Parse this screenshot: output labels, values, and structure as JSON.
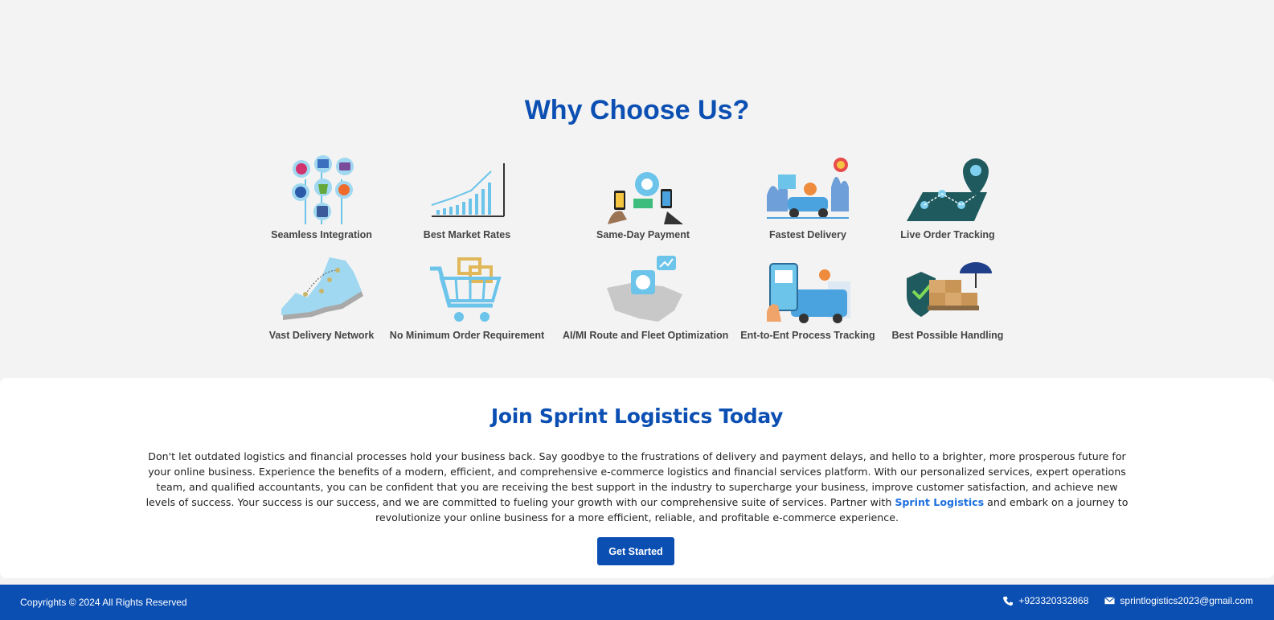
{
  "why": {
    "title": "Why Choose Us?",
    "features": [
      {
        "label": "Seamless Integration",
        "icon": "integration-icon"
      },
      {
        "label": "Best Market Rates",
        "icon": "market-rates-icon"
      },
      {
        "label": "Same-Day Payment",
        "icon": "payment-icon"
      },
      {
        "label": "Fastest Delivery",
        "icon": "delivery-icon"
      },
      {
        "label": "Live Order Tracking",
        "icon": "tracking-icon"
      },
      {
        "label": "Vast Delivery Network",
        "icon": "network-map-icon"
      },
      {
        "label": "No Minimum Order Requirement",
        "icon": "cart-icon"
      },
      {
        "label": "AI/MI Route and Fleet Optimization",
        "icon": "ai-route-icon"
      },
      {
        "label": "Ent-to-Ent Process Tracking",
        "icon": "process-tracking-icon"
      },
      {
        "label": "Best Possible Handling",
        "icon": "handling-icon"
      }
    ]
  },
  "join": {
    "title": "Join Sprint Logistics Today",
    "body_before": "Don't let outdated logistics and financial processes hold your business back. Say goodbye to the frustrations of delivery and payment delays, and hello to a brighter, more prosperous future for your online business. Experience the benefits of a modern, efficient, and comprehensive e-commerce logistics and financial services platform. With our personalized services, expert operations team, and qualified accountants, you can be confident that you are receiving the best support in the industry to supercharge your business, improve customer satisfaction, and achieve new levels of success. Your success is our success, and we are committed to fueling your growth with our comprehensive suite of services. Partner with ",
    "brand": "Sprint Logistics",
    "body_after": " and embark on a journey to revolutionize your online business for a more efficient, reliable, and profitable e-commerce experience.",
    "cta_label": "Get Started"
  },
  "footer": {
    "copyright": "Copyrights © 2024 All Rights Reserved",
    "phone": "+923320332868",
    "email": "sprintlogistics2023@gmail.com"
  },
  "colors": {
    "brand_blue": "#0b4fb3",
    "accent_light_blue": "#6cc4ea",
    "background": "#f3f3f3"
  }
}
